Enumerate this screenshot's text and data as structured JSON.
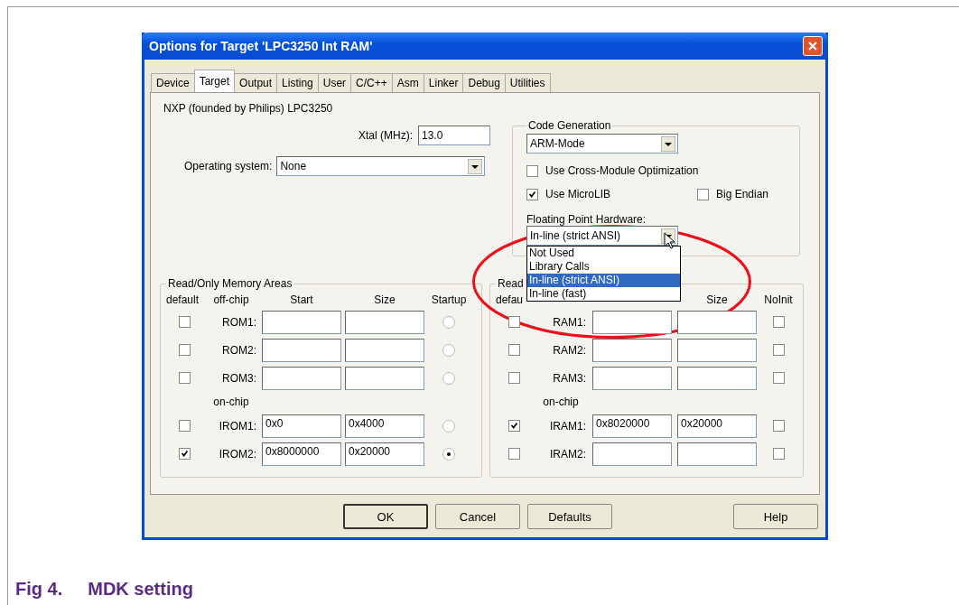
{
  "window": {
    "title": "Options for Target 'LPC3250 Int RAM'"
  },
  "tabs": [
    {
      "label": "Device",
      "selected": false
    },
    {
      "label": "Target",
      "selected": true
    },
    {
      "label": "Output",
      "selected": false
    },
    {
      "label": "Listing",
      "selected": false
    },
    {
      "label": "User",
      "selected": false
    },
    {
      "label": "C/C++",
      "selected": false
    },
    {
      "label": "Asm",
      "selected": false
    },
    {
      "label": "Linker",
      "selected": false
    },
    {
      "label": "Debug",
      "selected": false
    },
    {
      "label": "Utilities",
      "selected": false
    }
  ],
  "device": "NXP (founded by Philips) LPC3250",
  "xtal": {
    "label": "Xtal (MHz):",
    "value": "13.0"
  },
  "operating_system": {
    "label": "Operating system:",
    "value": "None"
  },
  "code_generation": {
    "title": "Code Generation",
    "mode": "ARM-Mode",
    "cross_module": {
      "label": "Use Cross-Module Optimization",
      "checked": false
    },
    "microlib": {
      "label": "Use MicroLIB",
      "checked": true
    },
    "big_endian": {
      "label": "Big Endian",
      "checked": false
    },
    "fp_label": "Floating Point Hardware:",
    "fp_value": "In-line (strict ANSI)",
    "fp_options": [
      {
        "label": "Not Used",
        "selected": false
      },
      {
        "label": "Library Calls",
        "selected": false
      },
      {
        "label": "In-line (strict ANSI)",
        "selected": true
      },
      {
        "label": "In-line (fast)",
        "selected": false
      }
    ]
  },
  "rom": {
    "title": "Read/Only Memory Areas",
    "headers": {
      "default": "default",
      "label": "off-chip",
      "start": "Start",
      "size": "Size",
      "last": "Startup"
    },
    "rows": [
      {
        "kind": "row",
        "default": false,
        "label": "ROM1:",
        "start": "",
        "size": "",
        "on": false
      },
      {
        "kind": "row",
        "default": false,
        "label": "ROM2:",
        "start": "",
        "size": "",
        "on": false
      },
      {
        "kind": "row",
        "default": false,
        "label": "ROM3:",
        "start": "",
        "size": "",
        "on": false
      },
      {
        "kind": "heading",
        "label": "on-chip"
      },
      {
        "kind": "row",
        "default": false,
        "label": "IROM1:",
        "start": "0x0",
        "size": "0x4000",
        "on": false
      },
      {
        "kind": "row",
        "default": true,
        "label": "IROM2:",
        "start": "0x8000000",
        "size": "0x20000",
        "on": true
      }
    ]
  },
  "ram": {
    "title": "Read",
    "headers": {
      "default": "defau",
      "size": "Size",
      "last": "NoInit"
    },
    "rows": [
      {
        "kind": "row",
        "default": false,
        "label": "RAM1:",
        "start": "",
        "size": "",
        "on": false
      },
      {
        "kind": "row",
        "default": false,
        "label": "RAM2:",
        "start": "",
        "size": "",
        "on": false
      },
      {
        "kind": "row",
        "default": false,
        "label": "RAM3:",
        "start": "",
        "size": "",
        "on": false
      },
      {
        "kind": "heading",
        "label": "on-chip"
      },
      {
        "kind": "row",
        "default": true,
        "label": "IRAM1:",
        "start": "0x8020000",
        "size": "0x20000",
        "on": false
      },
      {
        "kind": "row",
        "default": false,
        "label": "IRAM2:",
        "start": "",
        "size": "",
        "on": false
      }
    ]
  },
  "buttons": [
    {
      "label": "OK",
      "default": true
    },
    {
      "label": "Cancel",
      "default": false
    },
    {
      "label": "Defaults",
      "default": false
    },
    {
      "label": "Help",
      "default": false
    }
  ],
  "caption": {
    "number": "Fig 4.",
    "title": "MDK setting"
  }
}
